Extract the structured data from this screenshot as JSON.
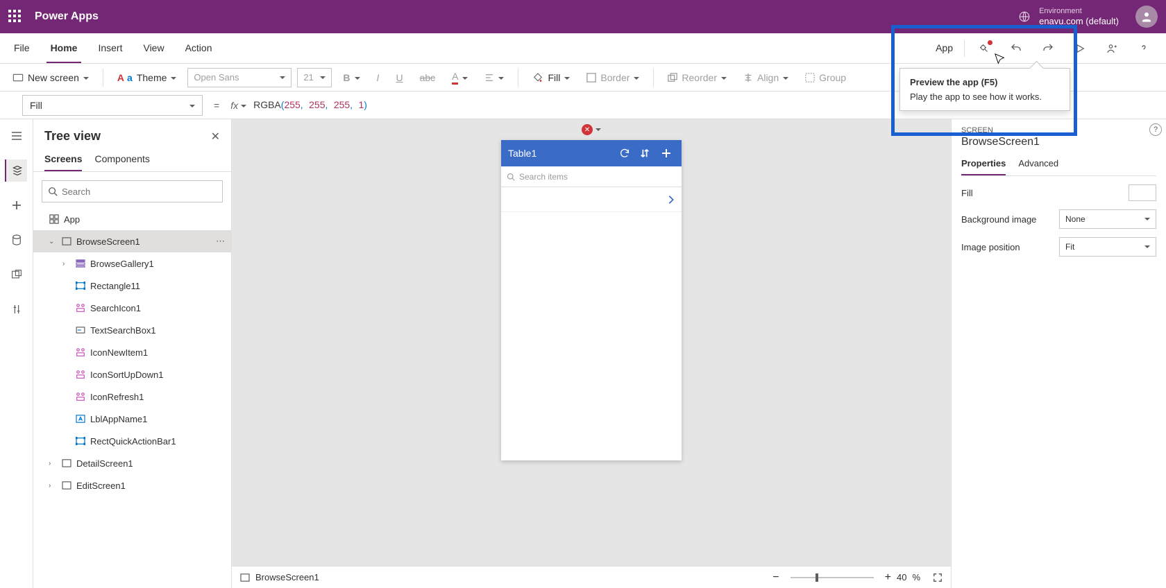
{
  "titlebar": {
    "app_name": "Power Apps",
    "env_label": "Environment",
    "env_name": "enavu.com (default)"
  },
  "menu": {
    "items": [
      "File",
      "Home",
      "Insert",
      "View",
      "Action"
    ],
    "active": "Home",
    "app_link": "App"
  },
  "toolbar": {
    "new_screen": "New screen",
    "theme": "Theme",
    "font": "Open Sans",
    "font_size": "21",
    "fill": "Fill",
    "border": "Border",
    "reorder": "Reorder",
    "align": "Align",
    "group": "Group"
  },
  "formula": {
    "property": "Fill",
    "fn": "RGBA",
    "args": [
      "255",
      "255",
      "255",
      "1"
    ]
  },
  "tree": {
    "title": "Tree view",
    "tabs": [
      "Screens",
      "Components"
    ],
    "search_placeholder": "Search",
    "app_node": "App",
    "nodes": [
      {
        "name": "BrowseScreen1",
        "sel": true,
        "depth": 0,
        "expandable": true,
        "expanded": true,
        "icon": "screen"
      },
      {
        "name": "BrowseGallery1",
        "depth": 1,
        "expandable": true,
        "expanded": false,
        "icon": "gallery"
      },
      {
        "name": "Rectangle11",
        "depth": 1,
        "icon": "rect"
      },
      {
        "name": "SearchIcon1",
        "depth": 1,
        "icon": "ctrl"
      },
      {
        "name": "TextSearchBox1",
        "depth": 1,
        "icon": "textbox"
      },
      {
        "name": "IconNewItem1",
        "depth": 1,
        "icon": "ctrl"
      },
      {
        "name": "IconSortUpDown1",
        "depth": 1,
        "icon": "ctrl"
      },
      {
        "name": "IconRefresh1",
        "depth": 1,
        "icon": "ctrl"
      },
      {
        "name": "LblAppName1",
        "depth": 1,
        "icon": "label"
      },
      {
        "name": "RectQuickActionBar1",
        "depth": 1,
        "icon": "rect"
      },
      {
        "name": "DetailScreen1",
        "depth": 0,
        "expandable": true,
        "expanded": false,
        "icon": "screen"
      },
      {
        "name": "EditScreen1",
        "depth": 0,
        "expandable": true,
        "expanded": false,
        "icon": "screen"
      }
    ]
  },
  "canvas": {
    "phone_title": "Table1",
    "phone_search": "Search items"
  },
  "statusbar": {
    "screen": "BrowseScreen1",
    "zoom": "40",
    "zoom_unit": "%"
  },
  "rightpane": {
    "category": "SCREEN",
    "name": "BrowseScreen1",
    "tabs": [
      "Properties",
      "Advanced"
    ],
    "props": {
      "fill_label": "Fill",
      "bg_label": "Background image",
      "bg_value": "None",
      "pos_label": "Image position",
      "pos_value": "Fit"
    }
  },
  "tooltip": {
    "title": "Preview the app (F5)",
    "body": "Play the app to see how it works."
  }
}
